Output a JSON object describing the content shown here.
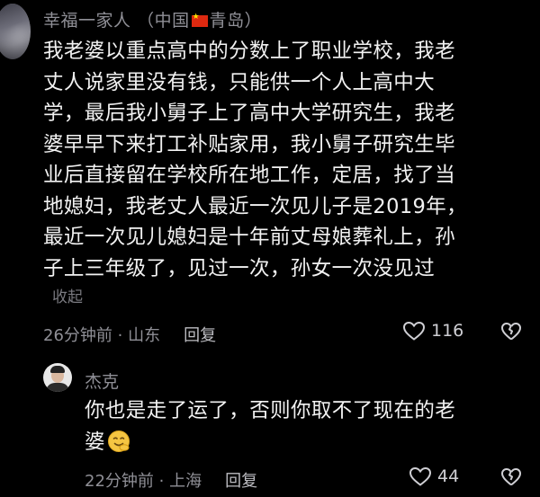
{
  "comments": [
    {
      "user": "幸福一家人",
      "location_prefix": "（中国",
      "location_suffix": "青岛）",
      "flag_icon": "china-flag-icon",
      "lines": [
        "我老婆以重点高中的分数上了职业学校，我老",
        "丈人说家里没有钱，只能供一个人上高中大",
        "学，最后我小舅子上了高中大学研究生，我老",
        "婆早早下来打工补贴家用，我小舅子研究生毕",
        "业后直接留在学校所在地工作，定居，找了当",
        "地媳妇，我老丈人最近一次见儿子是2019年，",
        "最近一次见儿媳妇是十年前丈母娘葬礼上，孙",
        "子上三年级了，见过一次，孙女一次没见过"
      ],
      "collapse_label": "收起",
      "time_location": "26分钟前 · 山东",
      "reply_label": "回复",
      "likes": "116"
    },
    {
      "user": "杰克",
      "lines": [
        "你也是走了运了，否则你取不了现在的老",
        "婆"
      ],
      "emoji_icon": "thinking-smile-emoji-icon",
      "time_location": "22分钟前 · 上海",
      "reply_label": "回复",
      "likes": "44"
    }
  ],
  "colors": {
    "background": "#000000",
    "text": "#f2f2f2",
    "meta": "#8f8f96"
  }
}
